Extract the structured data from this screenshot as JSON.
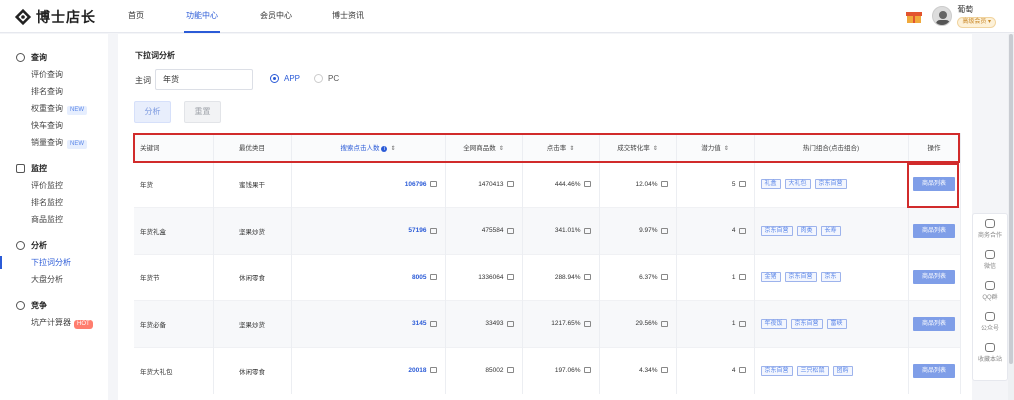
{
  "brand": {
    "name": "博士店长"
  },
  "nav": [
    "首页",
    "功能中心",
    "会员中心",
    "博士资讯"
  ],
  "nav_active": 1,
  "user": {
    "name": "葡萄",
    "level": "高级会员 ▾"
  },
  "sidebar": {
    "groups": [
      {
        "title": "查询",
        "items": [
          {
            "label": "评价查询"
          },
          {
            "label": "排名查询"
          },
          {
            "label": "权重查询",
            "tag": "NEW"
          },
          {
            "label": "快车查询"
          },
          {
            "label": "销量查询",
            "tag": "NEW"
          }
        ]
      },
      {
        "title": "监控",
        "items": [
          {
            "label": "评价监控"
          },
          {
            "label": "排名监控"
          },
          {
            "label": "商品监控"
          }
        ]
      },
      {
        "title": "分析",
        "items": [
          {
            "label": "下拉词分析",
            "active": true
          },
          {
            "label": "大盘分析"
          }
        ]
      },
      {
        "title": "竞争",
        "items": [
          {
            "label": "坑产计算器",
            "hot": "HOT"
          }
        ]
      }
    ]
  },
  "page": {
    "title": "下拉词分析",
    "keyword_label": "主词",
    "keyword_value": "年货",
    "radio_app": "APP",
    "radio_pc": "PC",
    "btn_analyze": "分析",
    "btn_reset": "重置"
  },
  "table": {
    "headers": [
      "关键词",
      "最优类目",
      "搜索点击人数",
      "全网商品数",
      "点击率",
      "成交转化率",
      "潜力值",
      "热门组合(点击组合)",
      "操作"
    ],
    "rows": [
      {
        "kw": "年货",
        "cat": "蜜饯果干",
        "clicks": "106796",
        "goods": "1470413",
        "ctr": "444.46%",
        "cvr": "12.04%",
        "pot": "5",
        "tags": [
          "礼盒",
          "大礼包",
          "京东自营"
        ],
        "op": "商品列表"
      },
      {
        "kw": "年货礼盒",
        "cat": "坚果炒货",
        "clicks": "57196",
        "goods": "475584",
        "ctr": "341.01%",
        "cvr": "9.97%",
        "pot": "4",
        "tags": [
          "京东自营",
          "肉类",
          "长寿"
        ],
        "op": "商品列表"
      },
      {
        "kw": "年货节",
        "cat": "休闲零食",
        "clicks": "8005",
        "goods": "1336064",
        "ctr": "288.94%",
        "cvr": "6.37%",
        "pot": "1",
        "tags": [
          "金猪",
          "京东自营",
          "京东"
        ],
        "op": "商品列表"
      },
      {
        "kw": "年货必备",
        "cat": "坚果炒货",
        "clicks": "3145",
        "goods": "33493",
        "ctr": "1217.65%",
        "cvr": "29.56%",
        "pot": "1",
        "tags": [
          "年夜饭",
          "京东自营",
          "富峡"
        ],
        "op": "商品列表"
      },
      {
        "kw": "年货大礼包",
        "cat": "休闲零食",
        "clicks": "20018",
        "goods": "85002",
        "ctr": "197.06%",
        "cvr": "4.34%",
        "pot": "4",
        "tags": [
          "京东自营",
          "三只松鼠",
          "团购"
        ],
        "op": "商品列表"
      }
    ]
  },
  "float_panel": [
    "商务合作",
    "微信",
    "QQ群",
    "公众号",
    "收藏本站"
  ],
  "colors": {
    "accent": "#2b5bd7",
    "highlight_box": "#d12b2b"
  }
}
